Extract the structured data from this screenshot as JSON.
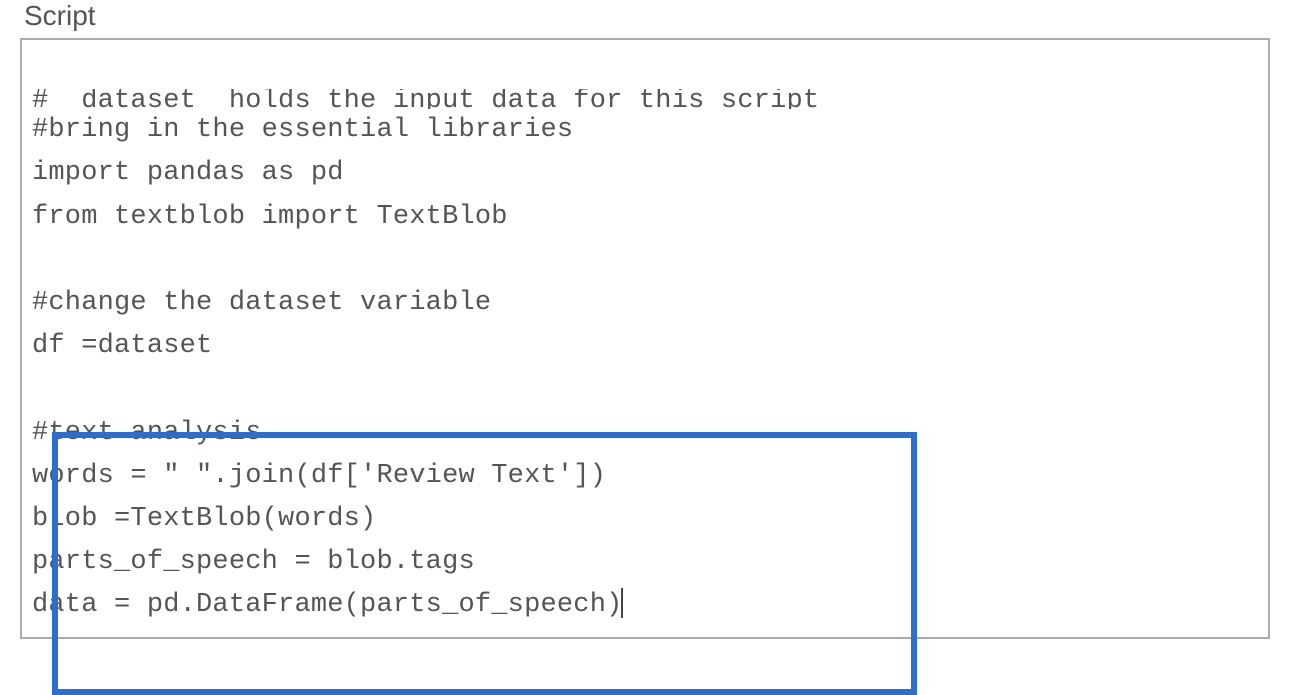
{
  "panel": {
    "title": "Script"
  },
  "code": {
    "partial_top": "#  dataset  holds the input data for this script",
    "line1": "#bring in the essential libraries",
    "line2": "import pandas as pd",
    "line3": "from textblob import TextBlob",
    "line4": "",
    "line5": "#change the dataset variable",
    "line6": "df =dataset",
    "line7": "",
    "line8": "#text analysis",
    "line9": "words = \" \".join(df['Review Text'])",
    "line10": "blob =TextBlob(words)",
    "line11": "parts_of_speech = blob.tags",
    "line12": "data = pd.DataFrame(parts_of_speech)"
  }
}
